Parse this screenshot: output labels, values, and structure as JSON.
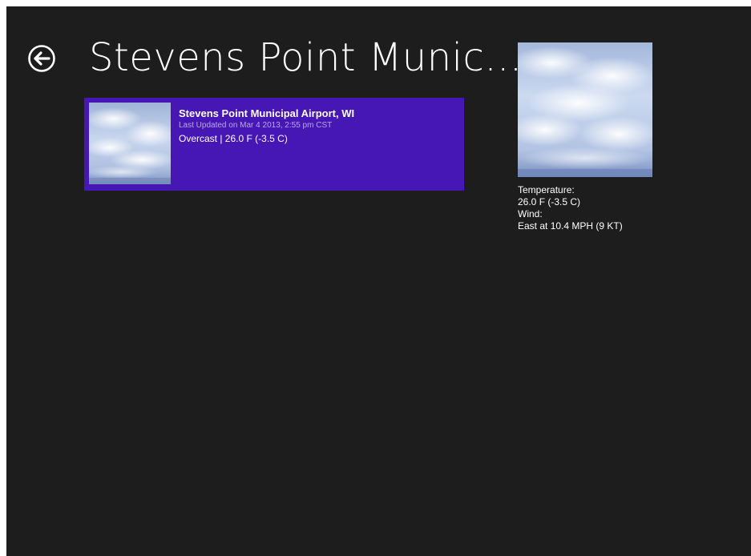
{
  "header": {
    "title": "Stevens Point Munic..."
  },
  "icons": {
    "back": "back-arrow-icon",
    "tile_image": "overcast-sky-image",
    "detail_image": "overcast-sky-image"
  },
  "colors": {
    "background": "#1d1d1d",
    "tile_accent": "#4617b4",
    "text": "#ffffff"
  },
  "station_tile": {
    "title": "Stevens Point Municipal Airport, WI",
    "updated": "Last Updated on Mar 4 2013, 2:55 pm CST",
    "summary": "Overcast | 26.0 F (-3.5 C)"
  },
  "details": {
    "temperature_label": "Temperature:",
    "temperature_value": "26.0 F (-3.5 C)",
    "wind_label": "Wind:",
    "wind_value": "East at 10.4 MPH (9 KT)"
  }
}
